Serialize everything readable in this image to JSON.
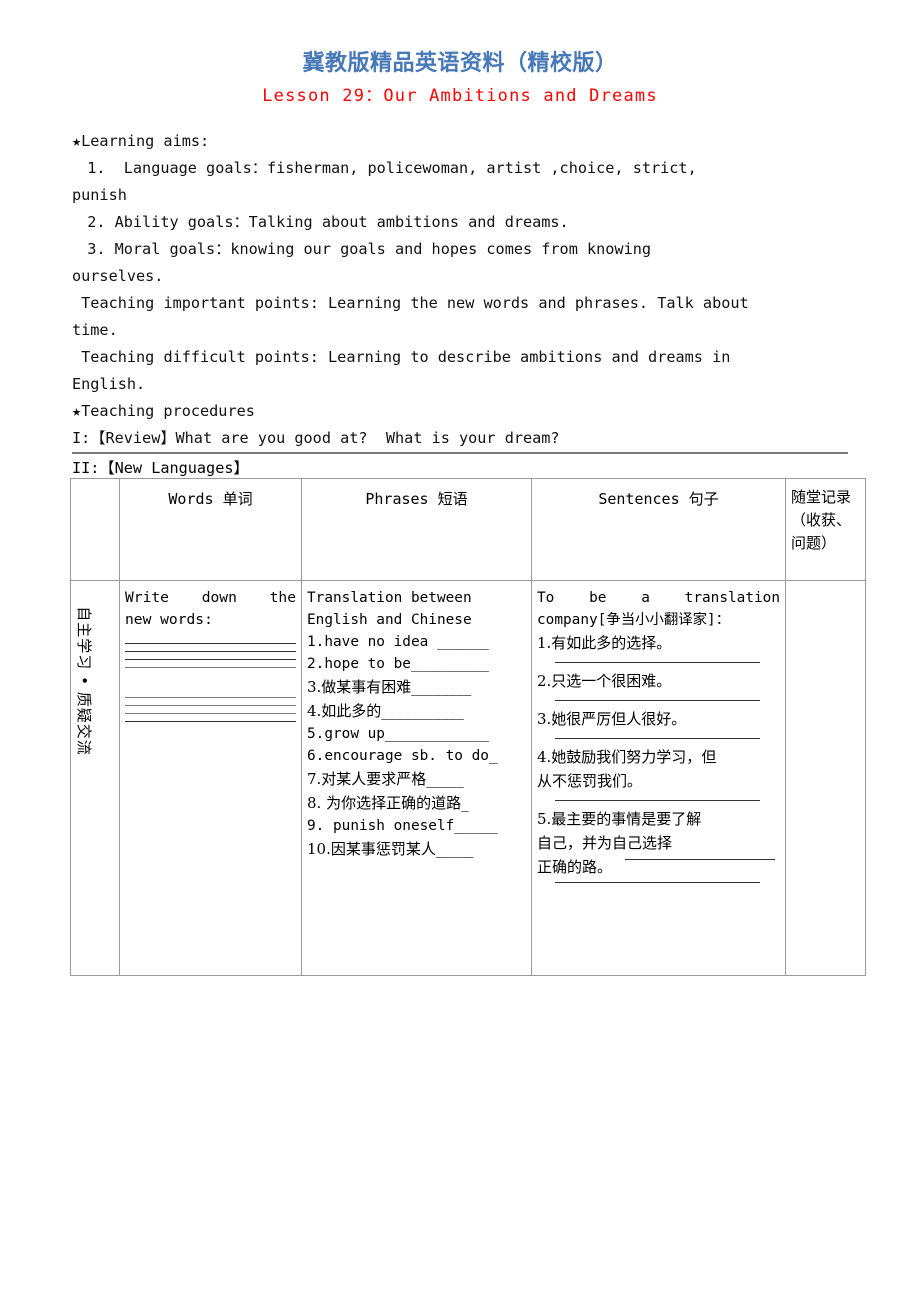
{
  "header": {
    "publisher_line": "冀教版精品英语资料（精校版）",
    "lesson_title": "Lesson 29：Our Ambitions and Dreams",
    "title_color_cn": "#4779B8",
    "title_color_lesson": "#FF0000"
  },
  "aims": {
    "heading": "★Learning aims:",
    "item1": "　1.  Language goals：fisherman, policewoman, artist ,choice, strict,",
    "item1_cont": "punish",
    "item2": "　2. Ability goals：Talking about ambitions and dreams.",
    "item3": "　3. Moral goals：knowing our goals and hopes comes from knowing",
    "item3_cont": "ourselves."
  },
  "points": {
    "important": " Teaching important points: Learning the new words and phrases. Talk about",
    "important_cont": "time.",
    "difficult": " Teaching difficult points: Learning to describe ambitions and dreams in",
    "difficult_cont": "English."
  },
  "procedures": {
    "heading": "★Teaching procedures",
    "step1": "I:【Review】What are you good at?  What is your dream?",
    "step2": "II:【New Languages】"
  },
  "table": {
    "headers": {
      "col0": "",
      "words": "Words 单词",
      "phrases": "Phrases 短语",
      "sentences": "Sentences 句子",
      "notes": "随堂记录（收获、问题）"
    },
    "row_label": "自主学习 • 质疑交流",
    "words_cell": {
      "prompt_line1": "Write down the",
      "prompt_line2": "new words:",
      "blank_line_count_group1": 4,
      "blank_line_count_group2": 4
    },
    "phrases_cell": {
      "intro_line1": "Translation between",
      "intro_line2": "English and Chinese",
      "items": [
        "1.have no idea ______",
        "2.hope to be_________",
        "3.做某事有困难________",
        "4.如此多的___________",
        "5.grow up____________",
        "6.encourage sb. to do_",
        "7.对某人要求严格_____",
        "8.  为你选择正确的道路_",
        "9.  punish oneself_____",
        "10.因某事惩罚某人_____"
      ]
    },
    "sentences_cell": {
      "intro_line1": "To  be  a  translation",
      "intro_line2": "company[争当小小翻译家]：",
      "items": [
        "1.有如此多的选择。",
        "2.只选一个很困难。",
        "3.她很严厉但人很好。",
        "4.她鼓励我们努力学习，但从不惩罚我们。",
        "5.最主要的事情是要了解自己，并为自己选择",
        "正确的路。"
      ],
      "item4_line1": "4.她鼓励我们努力学习，但",
      "item4_line2": "从不惩罚我们。",
      "item5_line1": " 5.最主要的事情是要了解",
      "item5_line2": "自己，并为自己选择",
      "item5_line3": " 正确的路。"
    }
  }
}
